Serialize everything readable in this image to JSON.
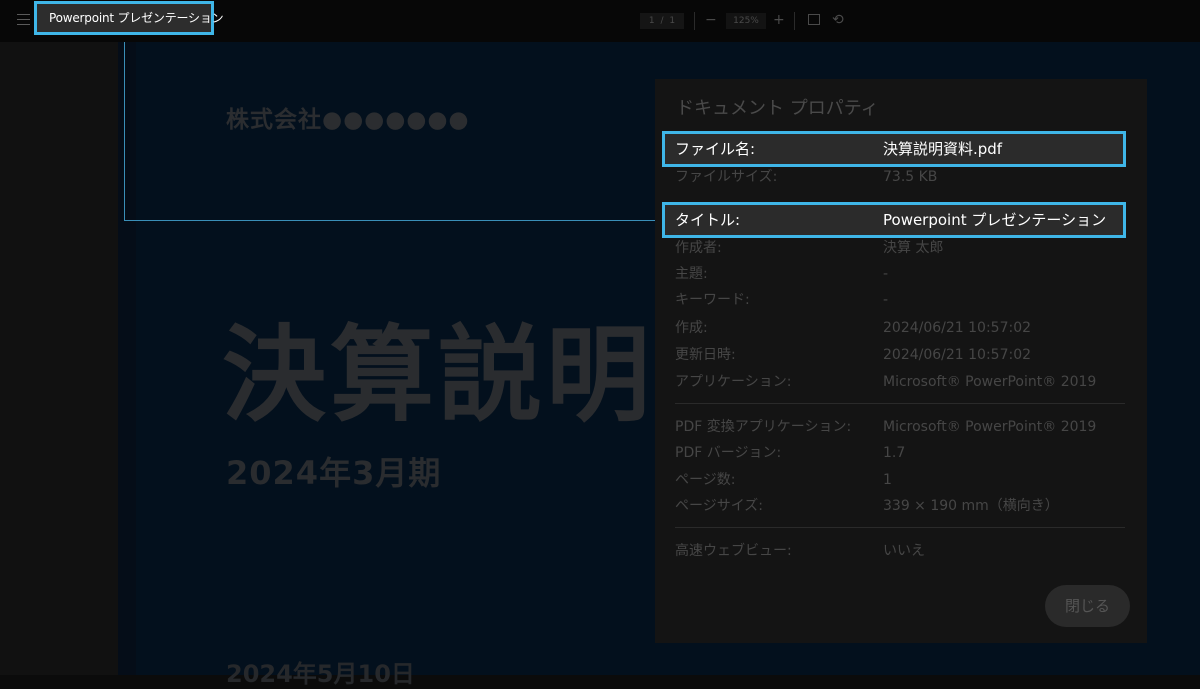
{
  "toolbar": {
    "doc_title": "Powerpoint プレゼンテーション",
    "page_current": "1",
    "page_sep": "/",
    "page_total": "1",
    "zoom_out": "−",
    "zoom": "125%",
    "zoom_in": "+",
    "icons": [
      "menu-icon",
      "fit-page-icon",
      "rotate-icon"
    ]
  },
  "slide": {
    "company": "株式会社●●●●●●●",
    "title": "決算説明",
    "subtitle": "2024年3月期",
    "date": "2024年5月10日"
  },
  "dialog": {
    "title": "ドキュメント プロパティ",
    "filename_label": "ファイル名:",
    "filename_value": "決算説明資料.pdf",
    "filesize_label": "ファイルサイズ:",
    "filesize_value": "73.5 KB",
    "doc_title_label": "タイトル:",
    "doc_title_value": "Powerpoint プレゼンテーション",
    "author_label": "作成者:",
    "author_value": "決算 太郎",
    "subject_label": "主題:",
    "subject_value": "-",
    "keywords_label": "キーワード:",
    "keywords_value": "-",
    "created_label": "作成:",
    "created_value": "2024/06/21 10:57:02",
    "modified_label": "更新日時:",
    "modified_value": "2024/06/21 10:57:02",
    "app_label": "アプリケーション:",
    "app_value": "Microsoft® PowerPoint® 2019",
    "pdf_producer_label": "PDF 変換アプリケーション:",
    "pdf_producer_value": "Microsoft® PowerPoint® 2019",
    "pdf_version_label": "PDF バージョン:",
    "pdf_version_value": "1.7",
    "page_count_label": "ページ数:",
    "page_count_value": "1",
    "page_size_label": "ページサイズ:",
    "page_size_value": "339 × 190 mm（横向き）",
    "fast_web_label": "高速ウェブビュー:",
    "fast_web_value": "いいえ",
    "close_label": "閉じる"
  },
  "colors": {
    "highlight": "#3fb6e8"
  }
}
